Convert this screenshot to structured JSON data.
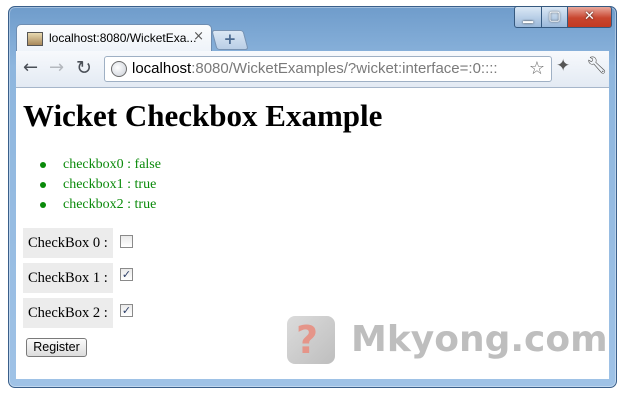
{
  "browser": {
    "tab_title": "localhost:8080/WicketExa...",
    "tab_close": "×",
    "new_tab": "+",
    "url_host": "localhost",
    "url_rest": ":8080/WicketExamples/?wicket:interface=:0::::",
    "controls": {
      "minimize": "▁",
      "maximize": "▢",
      "close": "✕"
    }
  },
  "page": {
    "heading": "Wicket Checkbox Example",
    "status_items": [
      "checkbox0 : false",
      "checkbox1 : true",
      "checkbox2 : true"
    ],
    "checkboxes": [
      {
        "label": "CheckBox 0 :",
        "checked": false,
        "mark": ""
      },
      {
        "label": "CheckBox 1 :",
        "checked": true,
        "mark": "✓"
      },
      {
        "label": "CheckBox 2 :",
        "checked": true,
        "mark": "✓"
      }
    ],
    "register_label": "Register",
    "status_color": "#0a8a0a"
  },
  "watermark": {
    "mark": "?",
    "text": "Mkyong.com"
  },
  "icons": [
    "back-arrow-icon",
    "forward-arrow-icon",
    "reload-icon",
    "globe-icon",
    "star-icon",
    "extension-icon",
    "wrench-icon",
    "favicon-icon"
  ]
}
